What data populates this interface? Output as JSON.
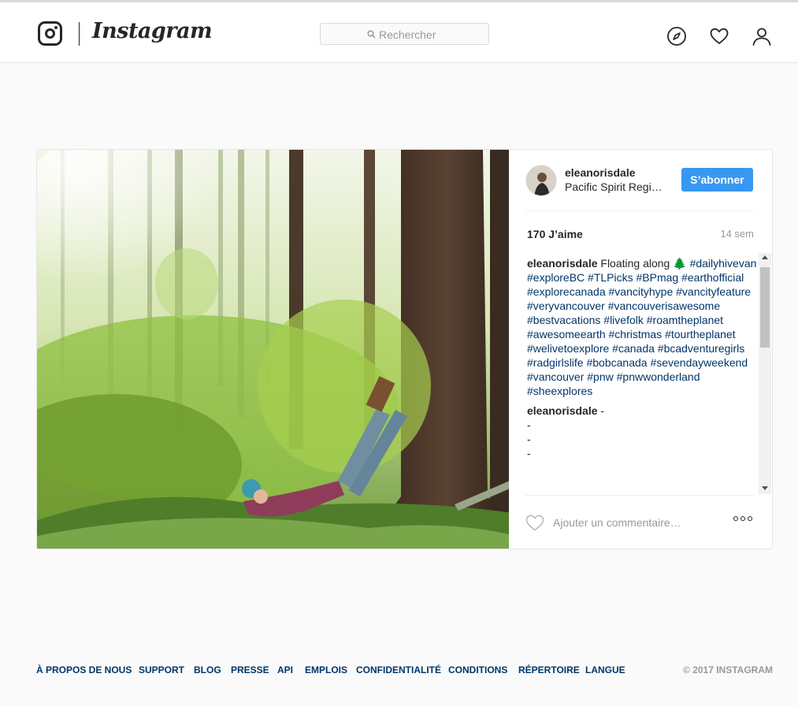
{
  "app": {
    "wordmark": "Instagram"
  },
  "header": {
    "search_placeholder": "Rechercher",
    "icons": [
      "instagram-camera-icon",
      "search-icon",
      "compass-icon",
      "heart-icon",
      "profile-icon"
    ]
  },
  "post": {
    "username": "eleanorisdale",
    "location": "Pacific Spirit Regi…",
    "follow_label": "S’abonner",
    "likes": "170 J’aime",
    "time": "14 sem",
    "caption_author": "eleanorisdale",
    "caption_text": "Floating along 🌲",
    "hashtags": "#dailyhivevan #exploreBC #TLPicks #BPmag #earthofficial #explorecanada #vancityhype #vancityfeature #veryvancouver #vancouverisawesome #bestvacations #livefolk #roamtheplanet #awesomeearth #christmas #tourtheplanet #welivetoexplore #canada #bcadventuregirls #radgirlslife #bobcanada #sevendayweekend #vancouver #pnw #pnwwonderland #sheexplores",
    "comment2_author": "eleanorisdale",
    "comment2_text": "-",
    "comment2_lines": [
      "-",
      "-",
      "-"
    ],
    "comment_placeholder": "Ajouter un commentaire…"
  },
  "footer": {
    "links": [
      "À PROPOS DE NOUS",
      "SUPPORT",
      "BLOG",
      "PRESSE",
      "API",
      "EMPLOIS",
      "CONFIDENTIALITÉ",
      "CONDITIONS",
      "RÉPERTOIRE",
      "LANGUE"
    ],
    "copyright": "© 2017 INSTAGRAM"
  },
  "colors": {
    "accent": "#3897f0",
    "link": "#003569",
    "muted": "#999999",
    "text": "#262626"
  }
}
